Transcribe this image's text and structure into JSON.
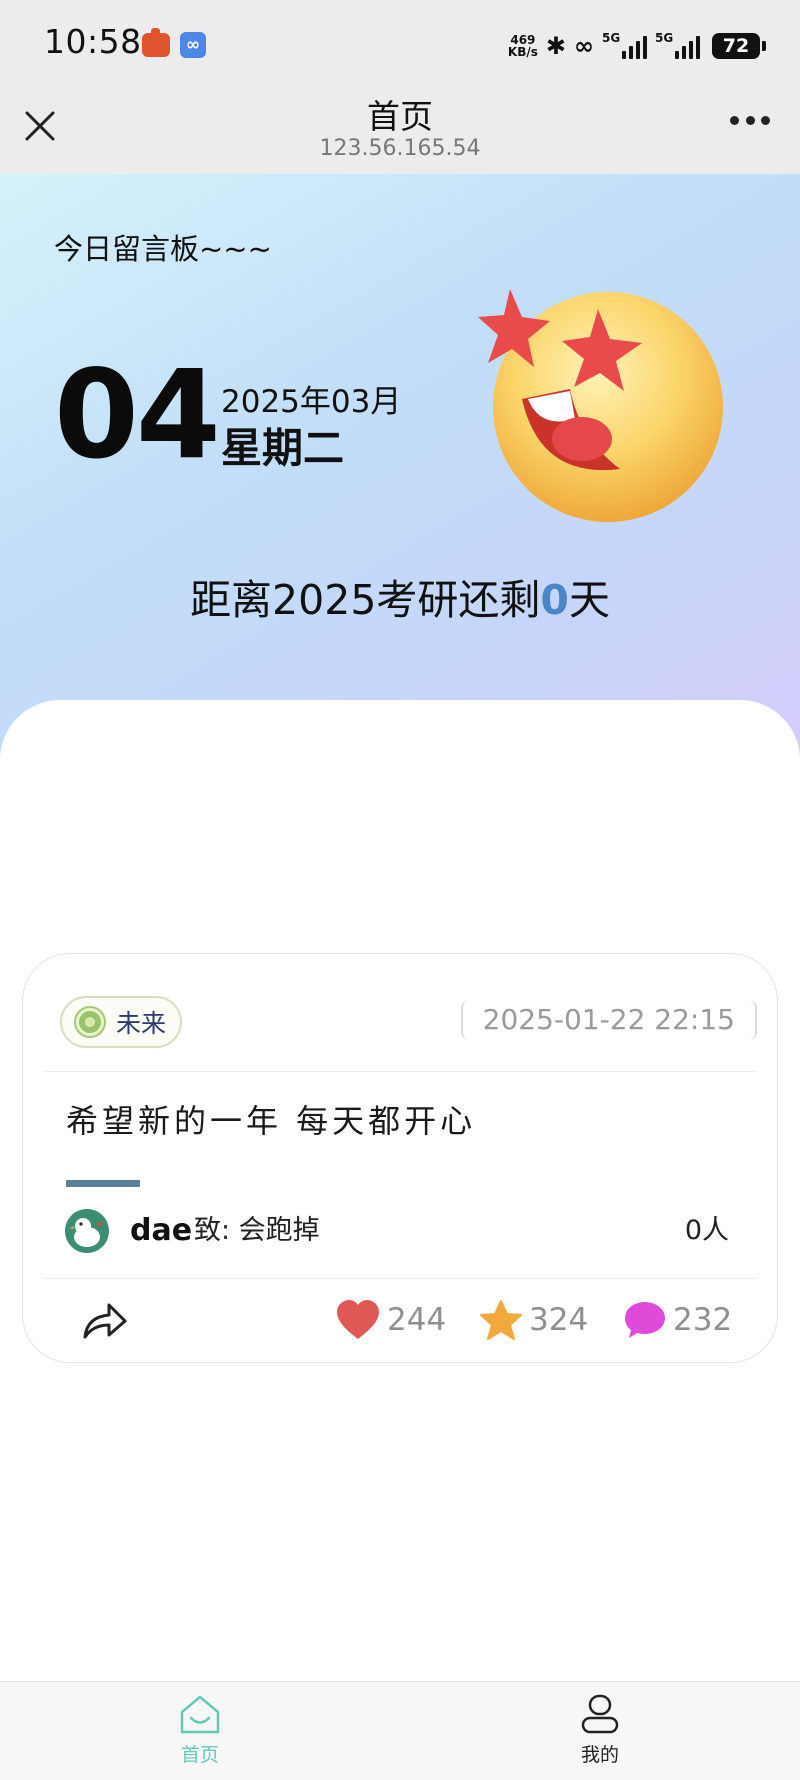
{
  "status_bar": {
    "time": "10:58",
    "net_speed_value": "469",
    "net_speed_unit": "KB/s",
    "signal1_label": "5G",
    "signal2_label": "5G",
    "battery": "72"
  },
  "nav": {
    "title": "首页",
    "subtitle": "123.56.165.54"
  },
  "hero": {
    "board_title": "今日留言板~~~",
    "day": "04",
    "year_month": "2025年03月",
    "weekday": "星期二",
    "countdown_prefix": "距离2025考研还剩",
    "countdown_days": "0",
    "countdown_suffix": "天"
  },
  "card": {
    "tag": "未来",
    "timestamp": "2025-01-22 22:15",
    "message": "希望新的一年 每天都开心",
    "author": "dae",
    "recipient": "致: 会跑掉",
    "people": "0人",
    "likes": "244",
    "favorites": "324",
    "comments": "232"
  },
  "tabbar": {
    "home_label": "首页",
    "me_label": "我的"
  },
  "colors": {
    "accent": "#66c9b8",
    "countdown": "#4a86c6",
    "heart": "#e05a55",
    "star": "#f1a93c",
    "comment": "#e04ad8"
  }
}
